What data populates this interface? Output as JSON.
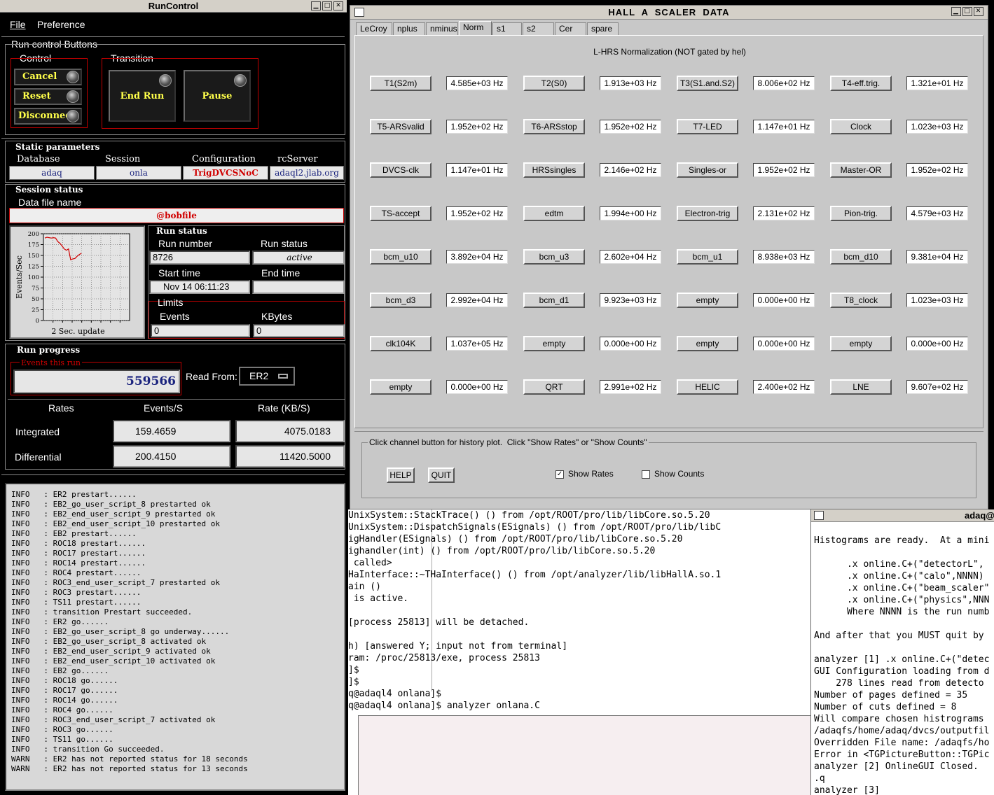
{
  "runcontrol": {
    "title": "RunControl",
    "menu": [
      "File",
      "Preference"
    ],
    "run_control_buttons_label": "Run control Buttons",
    "control_label": "Control",
    "transition_label": "Transition",
    "control_buttons": [
      "Cancel",
      "Reset",
      "Disconnect"
    ],
    "transition_buttons": [
      "End Run",
      "Pause"
    ],
    "static_parameters_label": "Static parameters",
    "static_params": [
      {
        "label": "Database",
        "value": "adaq"
      },
      {
        "label": "Session",
        "value": "onla"
      },
      {
        "label": "Configuration",
        "value": "TrigDVCSNoC"
      },
      {
        "label": "rcServer",
        "value": "adaql2.jlab.org"
      }
    ],
    "session_status_label": "Session status",
    "data_file_name_label": "Data file name",
    "data_file_name": "@bobfile",
    "chart": {
      "ylabel": "Events/Sec",
      "xlabel": "2 Sec. update",
      "yticks": [
        "200",
        "175",
        "150",
        "125",
        "100",
        "75",
        "50",
        "25",
        "0"
      ]
    },
    "run_status_label": "Run status",
    "run_number_label": "Run number",
    "run_number": "8726",
    "run_status_field_label": "Run status",
    "run_status": "active",
    "start_time_label": "Start time",
    "start_time": "Nov 14 06:11:23",
    "end_time_label": "End time",
    "end_time": "",
    "limits_label": "Limits",
    "events_label": "Events",
    "events_value": "0",
    "kbytes_label": "KBytes",
    "kbytes_value": "0",
    "run_progress_label": "Run progress",
    "events_this_run_label": "Events this run",
    "events_this_run": "559566",
    "read_from_label": "Read From:",
    "read_from_value": "ER2",
    "rates": {
      "header": [
        "Rates",
        "Events/S",
        "Rate (KB/S)"
      ],
      "integrated_label": "Integrated",
      "integrated_events": "159.4659",
      "integrated_rate": "4075.0183",
      "differential_label": "Differential",
      "differential_events": "200.4150",
      "differential_rate": "11420.5000"
    },
    "log": [
      "INFO   : ER2 prestart......",
      "INFO   : EB2_go_user_script_8 prestarted ok",
      "INFO   : EB2_end_user_script_9 prestarted ok",
      "INFO   : EB2_end_user_script_10 prestarted ok",
      "INFO   : EB2 prestart......",
      "INFO   : ROC18 prestart......",
      "INFO   : ROC17 prestart......",
      "INFO   : ROC14 prestart......",
      "INFO   : ROC4 prestart......",
      "INFO   : ROC3_end_user_script_7 prestarted ok",
      "INFO   : ROC3 prestart......",
      "INFO   : TS11 prestart......",
      "INFO   : transition Prestart succeeded.",
      "INFO   : ER2 go......",
      "INFO   : EB2_go_user_script_8 go underway......",
      "INFO   : EB2_go_user_script_8 activated ok",
      "INFO   : EB2_end_user_script_9 activated ok",
      "INFO   : EB2_end_user_script_10 activated ok",
      "INFO   : EB2 go......",
      "INFO   : ROC18 go......",
      "INFO   : ROC17 go......",
      "INFO   : ROC14 go......",
      "INFO   : ROC4 go......",
      "INFO   : ROC3_end_user_script_7 activated ok",
      "INFO   : ROC3 go......",
      "INFO   : TS11 go......",
      "INFO   : transition Go succeeded.",
      "WARN   : ER2 has not reported status for 18 seconds",
      "WARN   : ER2 has not reported status for 13 seconds"
    ]
  },
  "scaler": {
    "title": "HALL  A  SCALER  DATA",
    "tabs": [
      "LeCroy",
      "nplus",
      "nminus",
      "Norm",
      "s1",
      "s2",
      "Cer",
      "spare"
    ],
    "active_tab": "Norm",
    "heading": "L-HRS Normalization (NOT gated by hel)",
    "rows": [
      [
        [
          "T1(S2m)",
          "4.585e+03 Hz"
        ],
        [
          "T2(S0)",
          "1.913e+03 Hz"
        ],
        [
          "T3(S1.and.S2)",
          "8.006e+02 Hz"
        ],
        [
          "T4-eff.trig.",
          "1.321e+01 Hz"
        ]
      ],
      [
        [
          "T5-ARSvalid",
          "1.952e+02 Hz"
        ],
        [
          "T6-ARSstop",
          "1.952e+02 Hz"
        ],
        [
          "T7-LED",
          "1.147e+01 Hz"
        ],
        [
          "Clock",
          "1.023e+03 Hz"
        ]
      ],
      [
        [
          "DVCS-clk",
          "1.147e+01 Hz"
        ],
        [
          "HRSsingles",
          "2.146e+02 Hz"
        ],
        [
          "Singles-or",
          "1.952e+02 Hz"
        ],
        [
          "Master-OR",
          "1.952e+02 Hz"
        ]
      ],
      [
        [
          "TS-accept",
          "1.952e+02 Hz"
        ],
        [
          "edtm",
          "1.994e+00 Hz"
        ],
        [
          "Electron-trig",
          "2.131e+02 Hz"
        ],
        [
          "Pion-trig.",
          "4.579e+03 Hz"
        ]
      ],
      [
        [
          "bcm_u10",
          "3.892e+04 Hz"
        ],
        [
          "bcm_u3",
          "2.602e+04 Hz"
        ],
        [
          "bcm_u1",
          "8.938e+03 Hz"
        ],
        [
          "bcm_d10",
          "9.381e+04 Hz"
        ]
      ],
      [
        [
          "bcm_d3",
          "2.992e+04 Hz"
        ],
        [
          "bcm_d1",
          "9.923e+03 Hz"
        ],
        [
          "empty",
          "0.000e+00 Hz"
        ],
        [
          "T8_clock",
          "1.023e+03 Hz"
        ]
      ],
      [
        [
          "clk104K",
          "1.037e+05 Hz"
        ],
        [
          "empty",
          "0.000e+00 Hz"
        ],
        [
          "empty",
          "0.000e+00 Hz"
        ],
        [
          "empty",
          "0.000e+00 Hz"
        ]
      ],
      [
        [
          "empty",
          "0.000e+00 Hz"
        ],
        [
          "QRT",
          "2.991e+02 Hz"
        ],
        [
          "HELIC",
          "2.400e+02 Hz"
        ],
        [
          "LNE",
          "9.607e+02 Hz"
        ]
      ]
    ],
    "instructions": "Click channel button for history plot.  Click \"Show Rates\" or \"Show Counts\"",
    "help_label": "HELP",
    "quit_label": "QUIT",
    "show_rates_label": "Show Rates",
    "show_rates_checked": true,
    "show_counts_label": "Show Counts",
    "show_counts_checked": false
  },
  "terminal1": {
    "lines": [
      "UnixSystem::StackTrace() () from /opt/ROOT/pro/lib/libCore.so.5.20",
      "UnixSystem::DispatchSignals(ESignals) () from /opt/ROOT/pro/lib/libC",
      "igHandler(ESignals) () from /opt/ROOT/pro/lib/libCore.so.5.20",
      "ighandler(int) () from /opt/ROOT/pro/lib/libCore.so.5.20",
      " called>",
      "HaInterface::~THaInterface() () from /opt/analyzer/lib/libHallA.so.1",
      "ain ()",
      " is active.",
      "",
      "[process 25813] will be detached.",
      "",
      "h) [answered Y; input not from terminal]",
      "ram: /proc/25813/exe, process 25813",
      "]$",
      "]$",
      "q@adaql4 onlana]$",
      "q@adaql4 onlana]$ analyzer onlana.C"
    ]
  },
  "terminal2": {
    "title": "adaq@",
    "lines": [
      "Histograms are ready.  At a mini",
      "",
      "      .x online.C+(\"detectorL\",",
      "      .x online.C+(\"calo\",NNNN)",
      "      .x online.C+(\"beam_scaler\"",
      "      .x online.C+(\"physics\",NNN",
      "      Where NNNN is the run numb",
      "",
      "And after that you MUST quit by",
      "",
      "analyzer [1] .x online.C+(\"detec",
      "GUI Configuration loading from d",
      "    278 lines read from detecto",
      "Number of pages defined = 35",
      "Number of cuts defined = 8",
      "Will compare chosen histrograms",
      "/adaqfs/home/adaq/dvcs/outputfil",
      "Overridden File name: /adaqfs/ho",
      "Error in <TGPictureButton::TGPic",
      "analyzer [2] OnlineGUI Closed.",
      ".q",
      "analyzer [3]"
    ]
  },
  "chart_data": {
    "type": "line",
    "xlabel": "2 Sec. update",
    "ylabel": "Events/Sec",
    "ylim": [
      0,
      200
    ],
    "yticks": [
      0,
      25,
      50,
      75,
      100,
      125,
      150,
      175,
      200
    ],
    "series": [
      {
        "values": [
          190,
          192,
          191,
          190,
          191,
          190,
          182,
          178,
          172,
          165,
          162,
          165,
          140,
          142,
          143,
          148,
          152,
          155
        ]
      }
    ]
  }
}
